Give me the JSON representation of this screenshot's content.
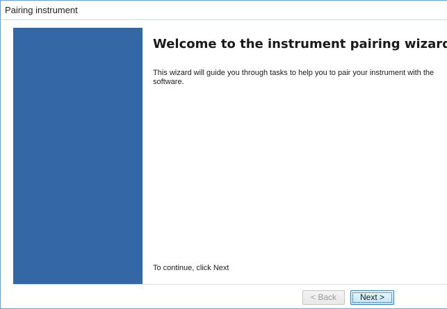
{
  "window": {
    "title": "Pairing instrument"
  },
  "wizard": {
    "heading": "Welcome to the instrument pairing wizard",
    "description": "This wizard will guide you through tasks to help you to pair your instrument with the software.",
    "footer_hint": "To continue, click Next"
  },
  "buttons": {
    "back_label": "< Back",
    "back_enabled": false,
    "next_label": "Next >",
    "next_enabled": true,
    "next_focused": true
  },
  "colors": {
    "side_panel": "#3367a6",
    "window_border": "#6e9ecf",
    "next_button_border": "#3c7fb1"
  }
}
